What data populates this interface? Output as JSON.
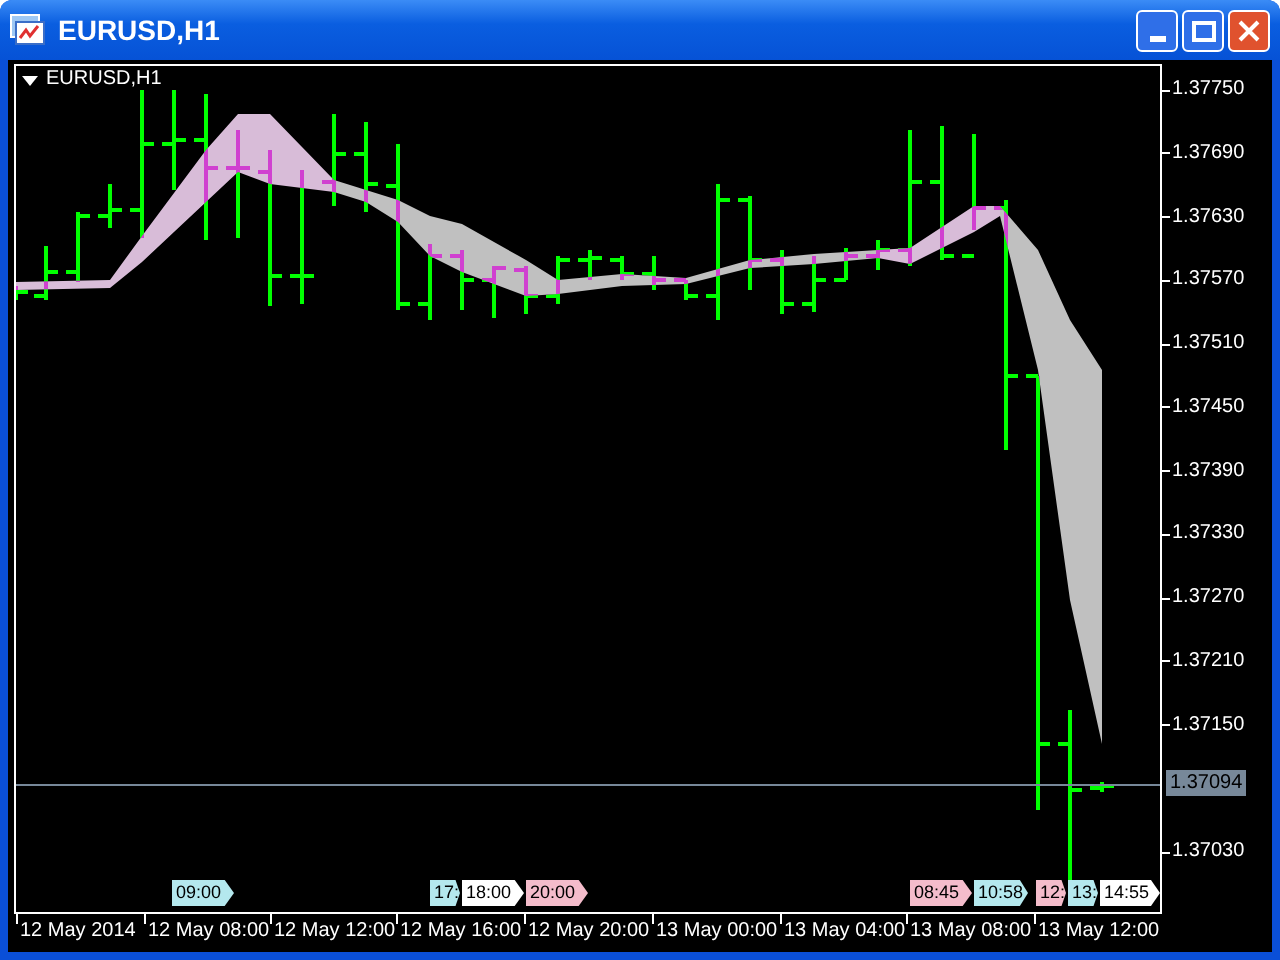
{
  "window": {
    "title": "EURUSD,H1"
  },
  "chart": {
    "label": "EURUSD,H1",
    "price_ticks": [
      "1.37750",
      "1.37690",
      "1.37630",
      "1.37570",
      "1.37510",
      "1.37450",
      "1.37390",
      "1.37330",
      "1.37270",
      "1.37210",
      "1.37150",
      "1.37030"
    ],
    "current_price": "1.37094",
    "time_labels": [
      "12 May 2014",
      "12 May 08:00",
      "12 May 12:00",
      "12 May 16:00",
      "12 May 20:00",
      "13 May 00:00",
      "13 May 04:00",
      "13 May 08:00",
      "13 May 12:00"
    ],
    "markers": [
      {
        "label": "09:00",
        "color": "#b4e8ee"
      },
      {
        "label": "17:",
        "color": "#b4e8ee"
      },
      {
        "label": "18:00",
        "color": "#ffffff"
      },
      {
        "label": "20:00",
        "color": "#f4bccb"
      },
      {
        "label": "08:45",
        "color": "#f4bccb"
      },
      {
        "label": "10:58",
        "color": "#b4e8ee"
      },
      {
        "label": "12:",
        "color": "#f4bccb"
      },
      {
        "label": "13:",
        "color": "#b4e8ee"
      },
      {
        "label": "14:55",
        "color": "#ffffff"
      }
    ]
  }
}
